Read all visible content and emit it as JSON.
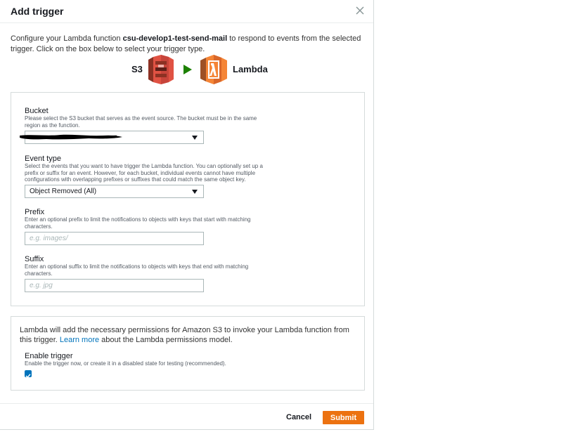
{
  "modal": {
    "title": "Add trigger",
    "close_icon": "close-icon"
  },
  "intro": {
    "prefix": "Configure your Lambda function ",
    "function_name": "csu-develop1-test-send-mail",
    "suffix": " to respond to events from the selected trigger. Click on the box below to select your trigger type."
  },
  "flow": {
    "source_label": "S3",
    "target_label": "Lambda",
    "source_icon": "s3-bucket-icon",
    "arrow_icon": "play-arrow-icon",
    "target_icon": "lambda-icon"
  },
  "bucket": {
    "label": "Bucket",
    "description": "Please select the S3 bucket that serves as the event source. The bucket must be in the same region as the function.",
    "value": ""
  },
  "event_type": {
    "label": "Event type",
    "description": "Select the events that you want to have trigger the Lambda function. You can optionally set up a prefix or suffix for an event. However, for each bucket, individual events cannot have multiple configurations with overlapping prefixes or suffixes that could match the same object key.",
    "value": "Object Removed (All)"
  },
  "prefix": {
    "label": "Prefix",
    "description": "Enter an optional prefix to limit the notifications to objects with keys that start with matching characters.",
    "placeholder": "e.g. images/",
    "value": ""
  },
  "suffix": {
    "label": "Suffix",
    "description": "Enter an optional suffix to limit the notifications to objects with keys that end with matching characters.",
    "placeholder": "e.g. jpg",
    "value": ""
  },
  "permissions": {
    "text_before": "Lambda will add the necessary permissions for Amazon S3 to invoke your Lambda function from this trigger. ",
    "link_text": "Learn more",
    "text_after": " about the Lambda permissions model."
  },
  "enable_trigger": {
    "label": "Enable trigger",
    "description": "Enable the trigger now, or create it in a disabled state for testing (recommended).",
    "checked": true
  },
  "footer": {
    "cancel_label": "Cancel",
    "submit_label": "Submit"
  },
  "colors": {
    "s3_red": "#e05243",
    "lambda_orange": "#f58536",
    "arrow_green": "#1d8102",
    "link_blue": "#0073bb",
    "submit_orange": "#ec7211"
  }
}
